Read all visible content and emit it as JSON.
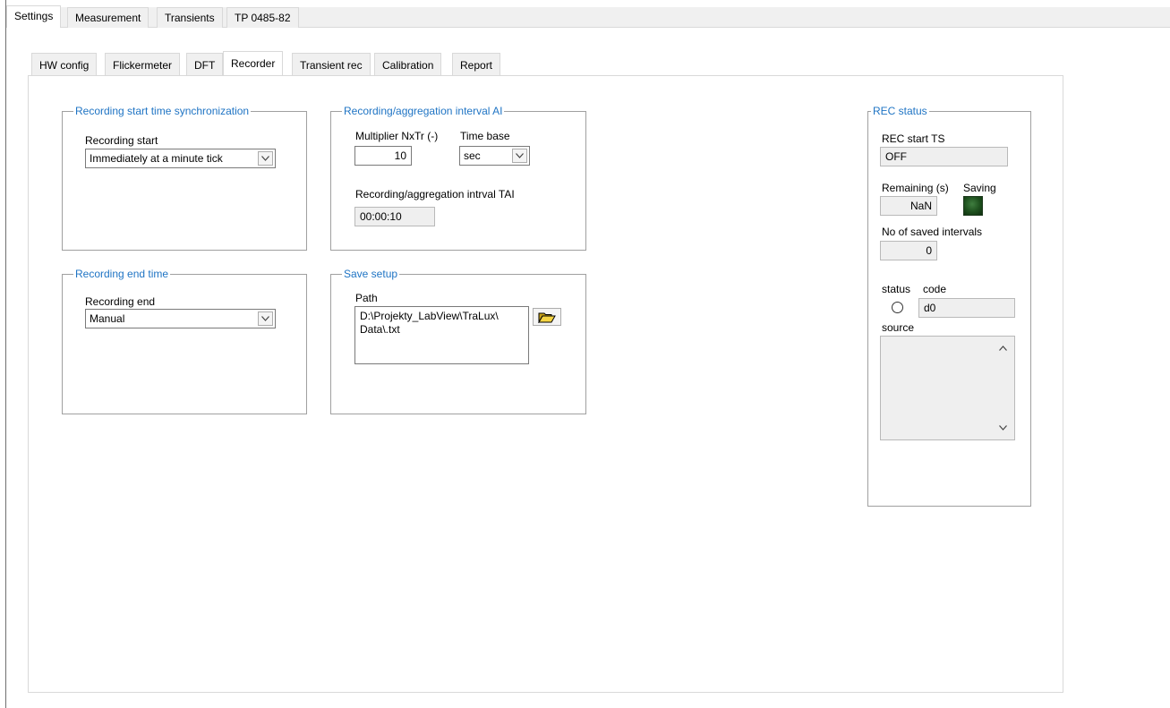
{
  "top_tabs": [
    "Settings",
    "Measurement",
    "Transients",
    "TP 0485-82"
  ],
  "sub_tabs": [
    "HW config",
    "Flickermeter",
    "DFT",
    "Recorder",
    "Transient rec",
    "Calibration",
    "Report"
  ],
  "sync_group": {
    "title": "Recording start time synchronization",
    "start_label": "Recording start",
    "start_value": "Immediately at a minute tick"
  },
  "interval_group": {
    "title": "Recording/aggregation interval AI",
    "multiplier_label": "Multiplier NxTr (-)",
    "multiplier_value": "10",
    "timebase_label": "Time base",
    "timebase_value": "sec",
    "interval_label": "Recording/aggregation intrval TAI",
    "interval_value": "00:00:10"
  },
  "end_group": {
    "title": "Recording end time",
    "end_label": "Recording end",
    "end_value": "Manual"
  },
  "save_group": {
    "title": "Save setup",
    "path_label": "Path",
    "path_line1": "D:\\Projekty_LabView\\TraLux\\",
    "path_line2": "Data\\.txt"
  },
  "rec_status": {
    "title": "REC status",
    "start_ts_label": "REC start TS",
    "start_ts_value": "OFF",
    "remaining_label": "Remaining (s)",
    "remaining_value": "NaN",
    "saving_label": "Saving",
    "saved_label": "No of saved intervals",
    "saved_value": "0",
    "status_label": "status",
    "code_label": "code",
    "code_value": "d0",
    "source_label": "source"
  },
  "icons": {
    "dropdown": "chevron-down-icon",
    "browse": "folder-open-icon",
    "scroll_up": "chevron-up-icon",
    "scroll_down": "chevron-down-icon"
  },
  "colors": {
    "group_title": "#1f74c4",
    "led_saving": "#1d4f1d"
  }
}
